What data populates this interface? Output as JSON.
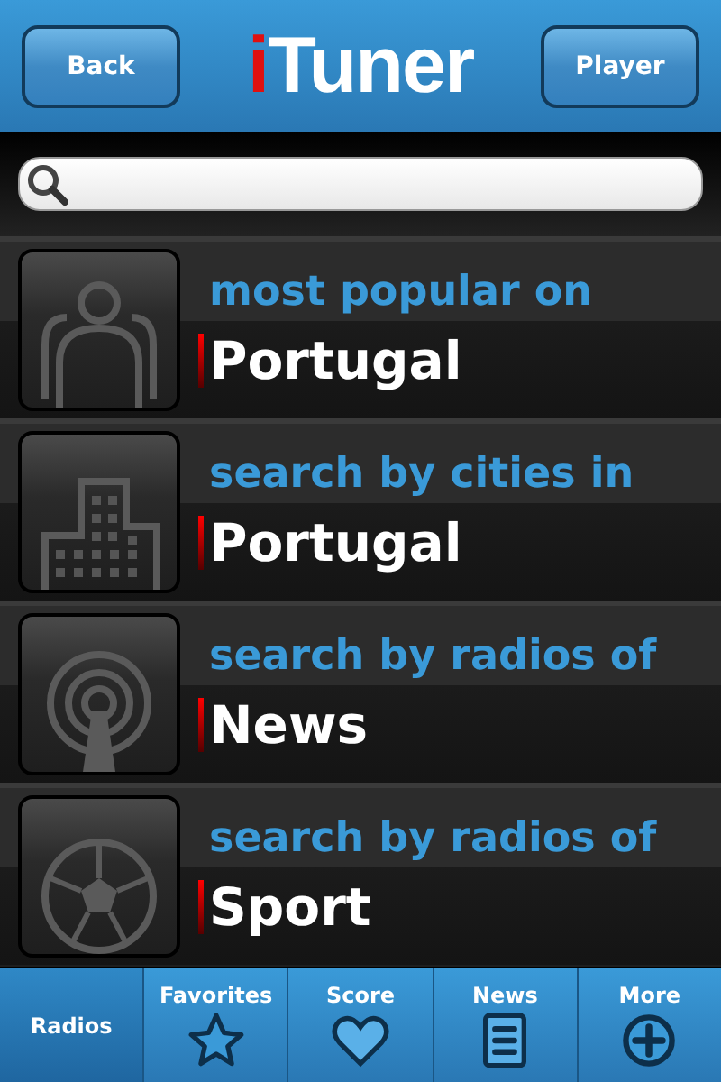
{
  "header": {
    "back": "Back",
    "logo_mark": "i",
    "logo_text": "Tuner",
    "player": "Player"
  },
  "rows": [
    {
      "line1": "most popular on",
      "line2": "Portugal"
    },
    {
      "line1": "search by cities in",
      "line2": "Portugal"
    },
    {
      "line1": "search by radios of",
      "line2": "News"
    },
    {
      "line1": "search by radios of",
      "line2": "Sport"
    }
  ],
  "tabs": [
    {
      "label": "Radios",
      "selected": true
    },
    {
      "label": "Favorites",
      "selected": false
    },
    {
      "label": "Score",
      "selected": false
    },
    {
      "label": "News",
      "selected": false
    },
    {
      "label": "More",
      "selected": false
    }
  ]
}
